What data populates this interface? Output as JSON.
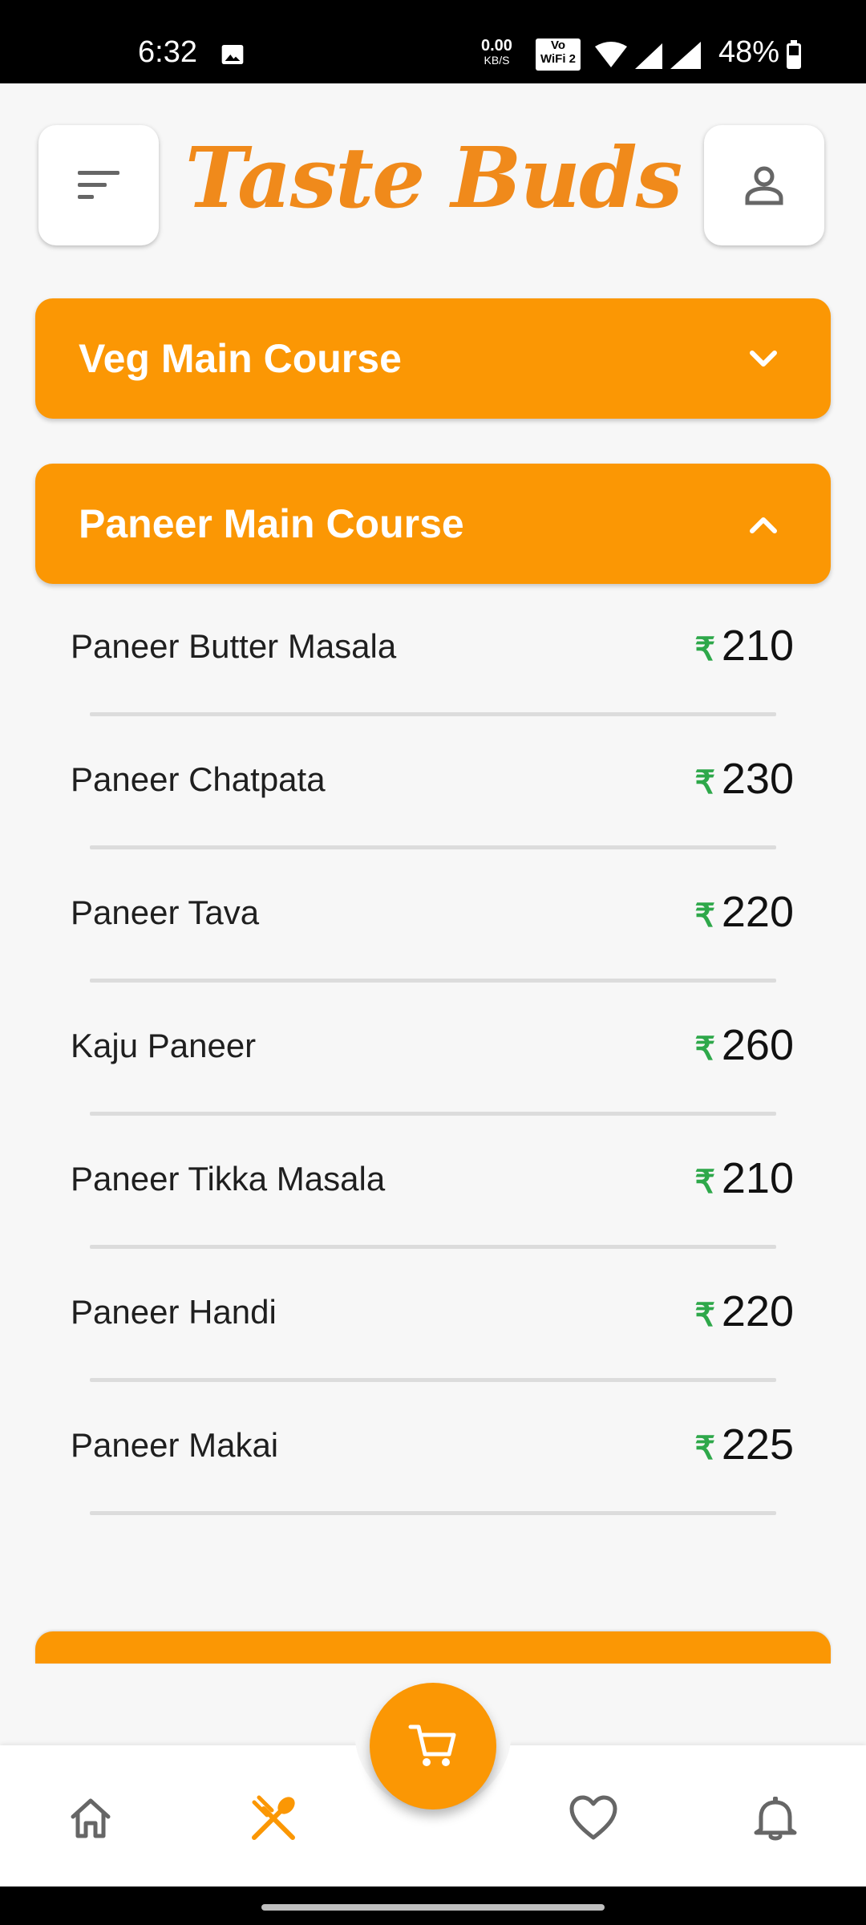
{
  "status_bar": {
    "time": "6:32",
    "net_speed": "0.00",
    "net_unit": "KB/S",
    "vowifi_top": "Vo",
    "vowifi_bottom": "WiFi 2",
    "battery": "48%"
  },
  "header": {
    "title": "Taste Buds",
    "menu_icon": "sort-icon",
    "profile_icon": "person-icon"
  },
  "sections": [
    {
      "title": "Veg Main Course",
      "expanded": false
    },
    {
      "title": "Paneer Main Course",
      "expanded": true
    }
  ],
  "currency_symbol": "₹",
  "items": [
    {
      "name": "Paneer Butter Masala",
      "price": "210"
    },
    {
      "name": "Paneer Chatpata",
      "price": "230"
    },
    {
      "name": "Paneer Tava",
      "price": "220"
    },
    {
      "name": "Kaju Paneer",
      "price": "260"
    },
    {
      "name": "Paneer Tikka Masala",
      "price": "210"
    },
    {
      "name": "Paneer Handi",
      "price": "220"
    },
    {
      "name": "Paneer Makai",
      "price": "225"
    }
  ],
  "bottom_nav": {
    "items": [
      "home-icon",
      "food-menu-icon",
      "cart-icon",
      "heart-icon",
      "bell-icon"
    ],
    "active": "food-menu-icon"
  },
  "colors": {
    "accent": "#fb9704",
    "brand": "#f08a1b",
    "rupee": "#2ea84a"
  }
}
